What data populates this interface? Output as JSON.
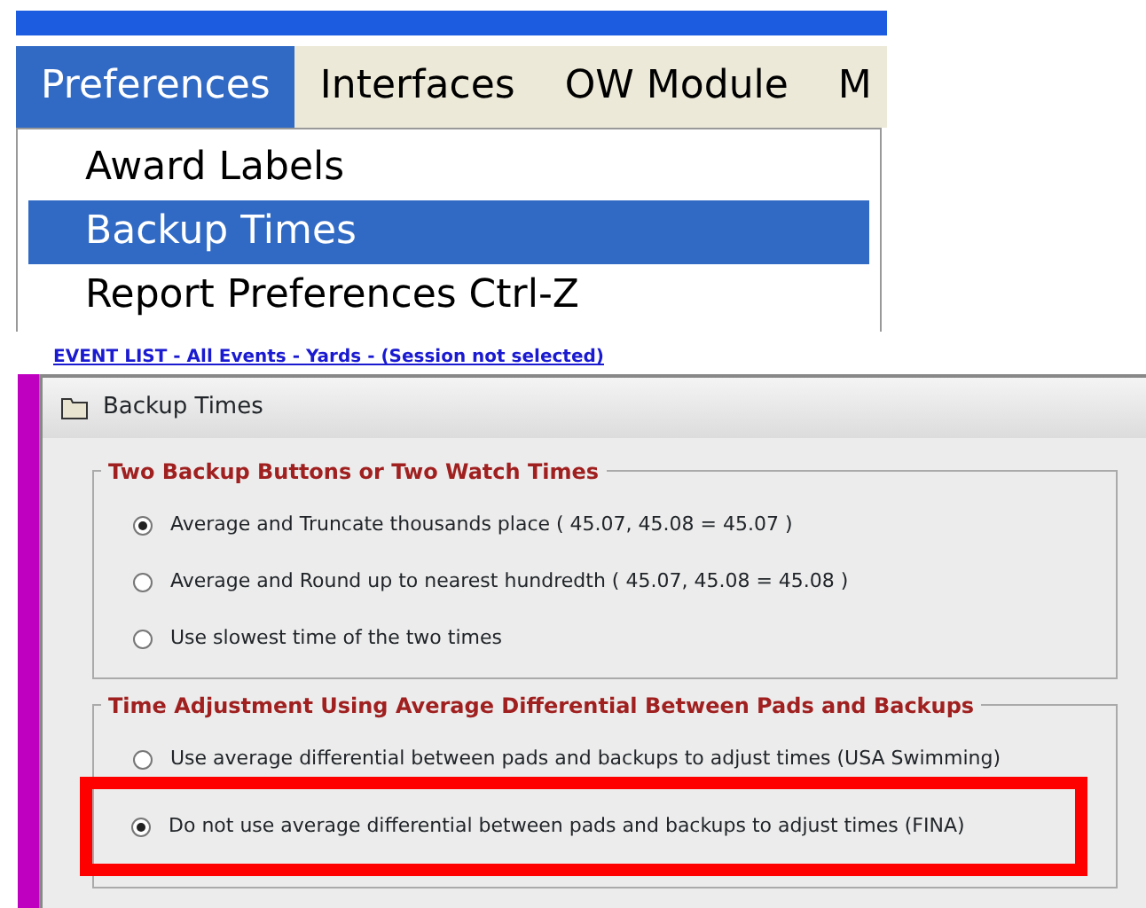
{
  "menu_bar": {
    "items": [
      {
        "label": "Preferences",
        "selected": true
      },
      {
        "label": "Interfaces",
        "selected": false
      },
      {
        "label": "OW Module",
        "selected": false
      },
      {
        "label": "M",
        "selected": false
      }
    ]
  },
  "dropdown": {
    "items": [
      {
        "label": "Award Labels",
        "selected": false
      },
      {
        "label": "Backup Times",
        "selected": true
      },
      {
        "label": "Report Preferences  Ctrl-Z",
        "selected": false
      }
    ]
  },
  "background_link": "EVENT LIST - All Events - Yards - (Session not selected)",
  "dialog": {
    "title": "Backup Times",
    "groups": [
      {
        "legend": "Two Backup Buttons or Two Watch Times",
        "options": [
          {
            "label": "Average and Truncate thousands place  ( 45.07, 45.08 = 45.07 )",
            "selected": true,
            "highlighted": false
          },
          {
            "label": "Average and Round up to nearest hundredth  ( 45.07, 45.08 = 45.08 )",
            "selected": false,
            "highlighted": false
          },
          {
            "label": "Use slowest time of the two times",
            "selected": false,
            "highlighted": false
          }
        ]
      },
      {
        "legend": "Time Adjustment Using Average Differential Between Pads and Backups",
        "options": [
          {
            "label": "Use average differential between pads and backups to adjust times (USA Swimming)",
            "selected": false,
            "highlighted": false
          },
          {
            "label": "Do not use average differential between pads and backups to adjust times (FINA)",
            "selected": true,
            "highlighted": true
          }
        ]
      }
    ]
  }
}
